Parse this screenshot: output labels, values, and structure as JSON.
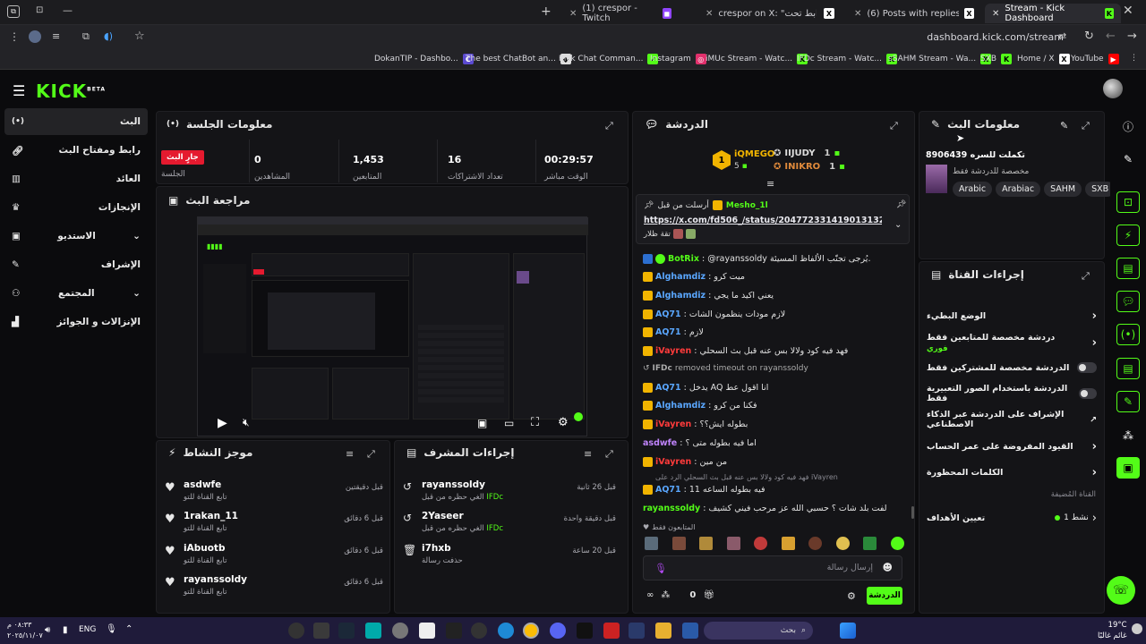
{
  "browser": {
    "tabs": [
      {
        "title": "(1) crespor - Twitch"
      },
      {
        "title": "crespor on X: \"حياكم الرابط تحت"
      },
      {
        "title": "(6) Posts with replies by FDS06"
      },
      {
        "title": "Stream - Kick Dashboard"
      }
    ],
    "url": "dashboard.kick.com/stream",
    "bookmarks": [
      "DokanTIP - Dashbo...",
      "The best ChatBot an...",
      "Kick Chat Comman...",
      "Instagram",
      "iMUc Stream - Watc...",
      "IFDc Stream - Watc...",
      "sSAHM Stream - Wa...",
      "SXB",
      "Home / X",
      "YouTube"
    ]
  },
  "app": {
    "logo": "KICK",
    "logo_sup": "BETA"
  },
  "sidebar": {
    "items": [
      {
        "label": "البث",
        "icon": "broadcast-icon"
      },
      {
        "label": "رابط ومفتاح البث",
        "icon": "link-icon"
      },
      {
        "label": "العائد",
        "icon": "chart-icon"
      },
      {
        "label": "الإنجازات",
        "icon": "trophy-icon"
      },
      {
        "label": "الاستديو",
        "icon": "studio-icon"
      },
      {
        "label": "الإشراف",
        "icon": "wrench-icon"
      },
      {
        "label": "المجتمع",
        "icon": "community-icon"
      },
      {
        "label": "الإنزالات و الجوائز",
        "icon": "drops-icon"
      }
    ]
  },
  "session": {
    "title": "معلومات الجلسة",
    "live_badge": "جارٍ البث",
    "live_label": "الجلسة",
    "stats": [
      {
        "value": "00:29:57",
        "label": "الوقت مباشر"
      },
      {
        "value": "16",
        "label": "تعداد الاشتراكات"
      },
      {
        "value": "1,453",
        "label": "المتابعين"
      },
      {
        "value": "0",
        "label": "المشاهدين"
      }
    ]
  },
  "preview": {
    "title": "مراجعة البث"
  },
  "activity": {
    "title": "موجز النشاط",
    "items": [
      {
        "name": "asdwfe",
        "sub": "تابع القناة للتو",
        "time": "قبل دقيقتين"
      },
      {
        "name": "1rakan_11",
        "sub": "تابع القناة للتو",
        "time": "قبل 6 دقائق"
      },
      {
        "name": "iAbuotb",
        "sub": "تابع القناة للتو",
        "time": "قبل 6 دقائق"
      },
      {
        "name": "rayanssoldy",
        "sub": "تابع القناة للتو",
        "time": "قبل 6 دقائق"
      }
    ]
  },
  "modactions": {
    "title": "إجراءات المشرف",
    "items": [
      {
        "name": "rayanssoldy",
        "sub_pre": "الغي حظره من قبل",
        "by": "IFDc",
        "time": "قبل 26 ثانية"
      },
      {
        "name": "2Yaseer",
        "sub_pre": "الغي حظره من قبل",
        "by": "IFDc",
        "time": "قبل دقيقة واحدة"
      },
      {
        "name": "i7hxb",
        "sub_pre": "حذفت رسالة",
        "by": "",
        "time": "قبل 20 ساعة"
      }
    ]
  },
  "chat": {
    "title": "الدردشة",
    "leaders": [
      {
        "rank": "1",
        "name": "iQMEGO",
        "count": "5"
      },
      {
        "name": "IIJUDY",
        "count": "1"
      },
      {
        "name": "INIKRO",
        "count": "1"
      }
    ],
    "pinned": {
      "label": "أرسلت من قبل",
      "user": "Mesho_1l",
      "link": "https://x.com/fd506_/status/2047723314190131326?s=46",
      "extra": "تقة ظلار"
    },
    "messages": [
      {
        "user": "BotRix",
        "color": "#53fc18",
        "text": ": @rayanssoldy يُرجى تجنّب الألفاظ المسيئة."
      },
      {
        "user": "Alghamdiz",
        "color": "#5aa7ff",
        "text": ": ميت كرو"
      },
      {
        "user": "Alghamdiz",
        "color": "#5aa7ff",
        "text": ": يعني اكيد ما يجي"
      },
      {
        "user": "AQ71",
        "color": "#5aa7ff",
        "text": ": لازم مودات ينظمون الشات"
      },
      {
        "user": "AQ71",
        "color": "#5aa7ff",
        "text": ": لازم"
      },
      {
        "user": "iVayren",
        "color": "#ff3b3b",
        "text": ": فهد فيه كود ولالا بس عنه قبل بث السحلي"
      },
      {
        "user": "IFDc",
        "color": "#aaaaaa",
        "text": " removed timeout on rayanssoldy",
        "system": true
      },
      {
        "user": "AQ71",
        "color": "#5aa7ff",
        "text": ": يدخل AQ انا اقول عط"
      },
      {
        "user": "Alghamdiz",
        "color": "#5aa7ff",
        "text": ": فكنا من كرو"
      },
      {
        "user": "iVayren",
        "color": "#ff3b3b",
        "text": ": بطوله ايش؟؟"
      },
      {
        "user": "asdwfe",
        "color": "#c084fc",
        "text": ": اما فيه بطوله متى ؟"
      },
      {
        "user": "iVayren",
        "color": "#ff3b3b",
        "text": ": من مين"
      },
      {
        "user": "AQ71",
        "color": "#5aa7ff",
        "text": ": فيه بطوله الساعه 11"
      },
      {
        "user": "rayanssoldy",
        "color": "#53fc18",
        "text": ": لفت بلد شات ؟ حسبي الله عز مرحب فيني كشيف"
      }
    ],
    "reply_hint": "فهد فيه كود ولالا بس عنه قبل بث السحلي   الرد على iVayren",
    "followers_only": "المتابعون فقط",
    "input_placeholder": "إرسال رسالة",
    "send_label": "الدردشة",
    "count": "0"
  },
  "streaminfo": {
    "title": "معلومات البث",
    "stream_title": "تكملت للسره 8906439",
    "category": "مخصصة للدردشة فقط",
    "tags": [
      "Arabic",
      "Arabiac",
      "SAHM",
      "SXB"
    ]
  },
  "quick": {
    "title": "إجراءات القناة",
    "items": [
      {
        "label": "الوضع البطيء",
        "type": "chevron"
      },
      {
        "label": "دردشة مخصصة للمتابعين فقط",
        "sub": "فوري",
        "type": "chevron"
      },
      {
        "label": "الدردشة مخصصة للمشتركين فقط",
        "type": "toggle"
      },
      {
        "label": "الدردشة باستخدام الصور التعبيرية فقط",
        "type": "toggle"
      },
      {
        "label": "الإشراف على الدردشة عبر الذكاء الاصطناعي",
        "type": "external"
      },
      {
        "label": "القيود المفروضة على عمر الحساب",
        "type": "chevron"
      },
      {
        "label": "الكلمات المحظورة",
        "type": "chevron"
      }
    ],
    "section": "القناة المُضيفة",
    "goal_label": "تعيين الأهداف",
    "goal_value": "نشط 1"
  },
  "taskbar": {
    "lang": "ENG",
    "time": "٠٨:٣٣ م",
    "date": "٢٠٢٥/١١/٠٧",
    "search": "بحث",
    "weather_temp": "19°C",
    "weather_text": "غائم غالبًا"
  },
  "colors": {
    "accent": "#53fc18",
    "live": "#e51a2f",
    "bg": "#0b0b0d",
    "panel": "#141417"
  }
}
